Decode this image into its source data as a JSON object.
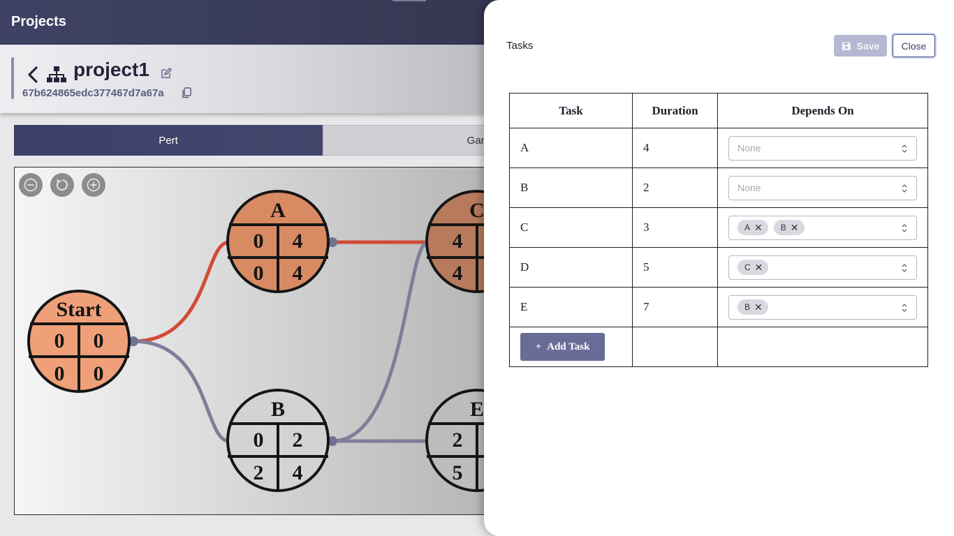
{
  "app": {
    "title": "Projects"
  },
  "project": {
    "name": "project1",
    "id": "67b624865edc377467d7a67a"
  },
  "tabs": [
    {
      "label": "Pert"
    },
    {
      "label": "Gantt"
    }
  ],
  "graph": {
    "nodes": [
      {
        "label": "Start",
        "es": "0",
        "ef": "0",
        "ls": "0",
        "lf": "0",
        "critical": true
      },
      {
        "label": "A",
        "es": "0",
        "ef": "4",
        "ls": "0",
        "lf": "4",
        "critical": true
      },
      {
        "label": "B",
        "es": "0",
        "ef": "2",
        "ls": "2",
        "lf": "4",
        "critical": false
      },
      {
        "label": "C",
        "es": "4",
        "ls": "4",
        "critical": true
      },
      {
        "label": "E",
        "es": "2",
        "ls": "5",
        "critical": false
      }
    ],
    "colors": {
      "critical_node": "#e08f68",
      "normal_node": "#d6d6d6",
      "critical_edge": "#d24a35",
      "normal_edge": "#7d7f98"
    }
  },
  "panel": {
    "title": "Tasks",
    "save_label": "Save",
    "close_label": "Close",
    "columns": {
      "task": "Task",
      "duration": "Duration",
      "depends_on": "Depends On"
    },
    "placeholder": "None",
    "rows": [
      {
        "task": "A",
        "duration": "4",
        "depends": []
      },
      {
        "task": "B",
        "duration": "2",
        "depends": []
      },
      {
        "task": "C",
        "duration": "3",
        "depends": [
          "A",
          "B"
        ]
      },
      {
        "task": "D",
        "duration": "5",
        "depends": [
          "C"
        ]
      },
      {
        "task": "E",
        "duration": "7",
        "depends": [
          "B"
        ]
      }
    ],
    "add_task_label": "Add Task"
  }
}
